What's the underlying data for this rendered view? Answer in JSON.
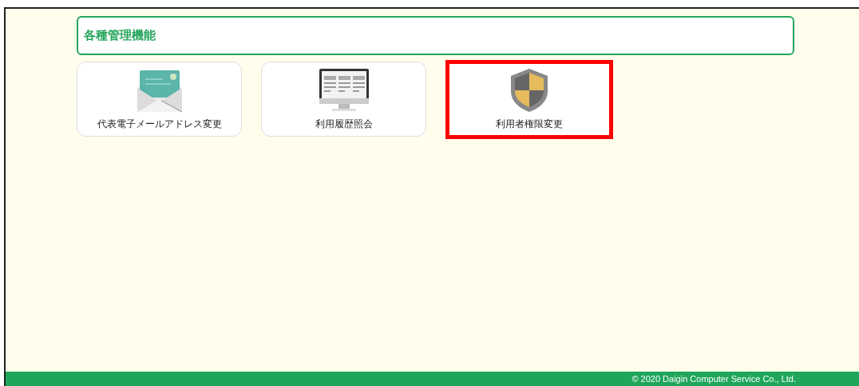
{
  "section": {
    "title": "各種管理機能"
  },
  "menu_items": [
    {
      "kind": "mail",
      "label": "代表電子メールアドレス変更",
      "highlighted": false
    },
    {
      "kind": "monitor",
      "label": "利用履歴照会",
      "highlighted": false
    },
    {
      "kind": "shield",
      "label": "利用者権限変更",
      "highlighted": true
    }
  ],
  "footer": {
    "copyright": "© 2020 Daigin Computer Service Co., Ltd."
  }
}
